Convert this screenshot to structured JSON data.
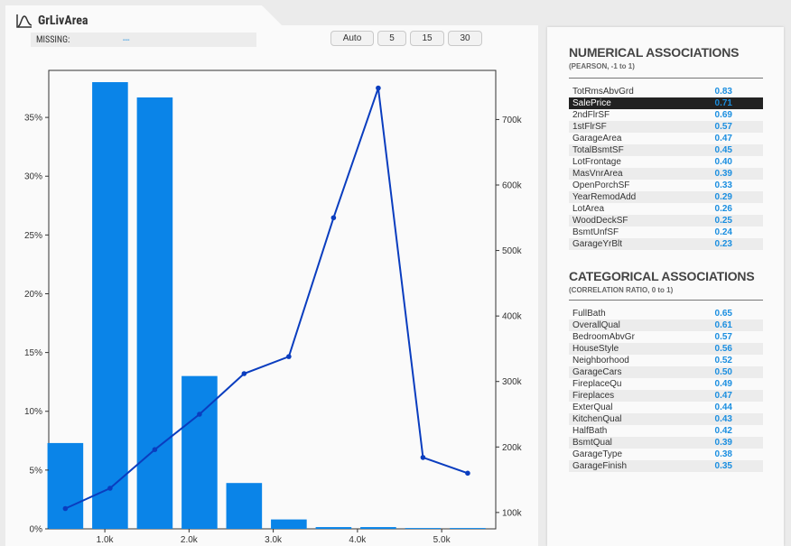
{
  "header": {
    "title": "GrLivArea",
    "missing_label": "MISSING:",
    "missing_value": "---",
    "bin_buttons": [
      "Auto",
      "5",
      "15",
      "30"
    ]
  },
  "colors": {
    "bar": "#0a84e8",
    "line": "#0a3dbf",
    "accent": "#1a8ee0"
  },
  "chart_data": {
    "type": "bar",
    "x_ticks": [
      "1.0k",
      "2.0k",
      "3.0k",
      "4.0k",
      "5.0k"
    ],
    "x_tick_values": [
      1000,
      2000,
      3000,
      4000,
      5000
    ],
    "xlim": [
      334,
      5642
    ],
    "bins": [
      {
        "center": 531,
        "pct": 7.3
      },
      {
        "center": 1062,
        "pct": 38.0
      },
      {
        "center": 1593,
        "pct": 36.7
      },
      {
        "center": 2124,
        "pct": 13.0
      },
      {
        "center": 2654,
        "pct": 3.9
      },
      {
        "center": 3185,
        "pct": 0.8
      },
      {
        "center": 3716,
        "pct": 0.15
      },
      {
        "center": 4247,
        "pct": 0.15
      },
      {
        "center": 4778,
        "pct": 0.07
      },
      {
        "center": 5309,
        "pct": 0.07
      }
    ],
    "y_left_ticks": [
      "0%",
      "5%",
      "10%",
      "15%",
      "20%",
      "25%",
      "30%",
      "35%"
    ],
    "y_left_tick_values": [
      0,
      5,
      10,
      15,
      20,
      25,
      30,
      35
    ],
    "ylim_left": [
      0,
      39
    ],
    "line_values": [
      106000,
      137000,
      196000,
      250000,
      312000,
      338000,
      550000,
      748000,
      184000,
      160000
    ],
    "y_right_ticks": [
      "100k",
      "200k",
      "300k",
      "400k",
      "500k",
      "600k",
      "700k"
    ],
    "y_right_tick_values": [
      100000,
      200000,
      300000,
      400000,
      500000,
      600000,
      700000
    ],
    "ylim_right": [
      75000,
      775000
    ]
  },
  "numerical": {
    "title": "NUMERICAL ASSOCIATIONS",
    "subtitle": "(PEARSON, -1 to 1)",
    "items": [
      {
        "name": "TotRmsAbvGrd",
        "value": "0.83"
      },
      {
        "name": "SalePrice",
        "value": "0.71",
        "highlight": true
      },
      {
        "name": "2ndFlrSF",
        "value": "0.69"
      },
      {
        "name": "1stFlrSF",
        "value": "0.57"
      },
      {
        "name": "GarageArea",
        "value": "0.47"
      },
      {
        "name": "TotalBsmtSF",
        "value": "0.45"
      },
      {
        "name": "LotFrontage",
        "value": "0.40"
      },
      {
        "name": "MasVnrArea",
        "value": "0.39"
      },
      {
        "name": "OpenPorchSF",
        "value": "0.33"
      },
      {
        "name": "YearRemodAdd",
        "value": "0.29"
      },
      {
        "name": "LotArea",
        "value": "0.26"
      },
      {
        "name": "WoodDeckSF",
        "value": "0.25"
      },
      {
        "name": "BsmtUnfSF",
        "value": "0.24"
      },
      {
        "name": "GarageYrBlt",
        "value": "0.23"
      }
    ]
  },
  "categorical": {
    "title": "CATEGORICAL ASSOCIATIONS",
    "subtitle": "(CORRELATION RATIO, 0 to 1)",
    "items": [
      {
        "name": "FullBath",
        "value": "0.65"
      },
      {
        "name": "OverallQual",
        "value": "0.61"
      },
      {
        "name": "BedroomAbvGr",
        "value": "0.57"
      },
      {
        "name": "HouseStyle",
        "value": "0.56"
      },
      {
        "name": "Neighborhood",
        "value": "0.52"
      },
      {
        "name": "GarageCars",
        "value": "0.50"
      },
      {
        "name": "FireplaceQu",
        "value": "0.49"
      },
      {
        "name": "Fireplaces",
        "value": "0.47"
      },
      {
        "name": "ExterQual",
        "value": "0.44"
      },
      {
        "name": "KitchenQual",
        "value": "0.43"
      },
      {
        "name": "HalfBath",
        "value": "0.42"
      },
      {
        "name": "BsmtQual",
        "value": "0.39"
      },
      {
        "name": "GarageType",
        "value": "0.38"
      },
      {
        "name": "GarageFinish",
        "value": "0.35"
      }
    ]
  }
}
